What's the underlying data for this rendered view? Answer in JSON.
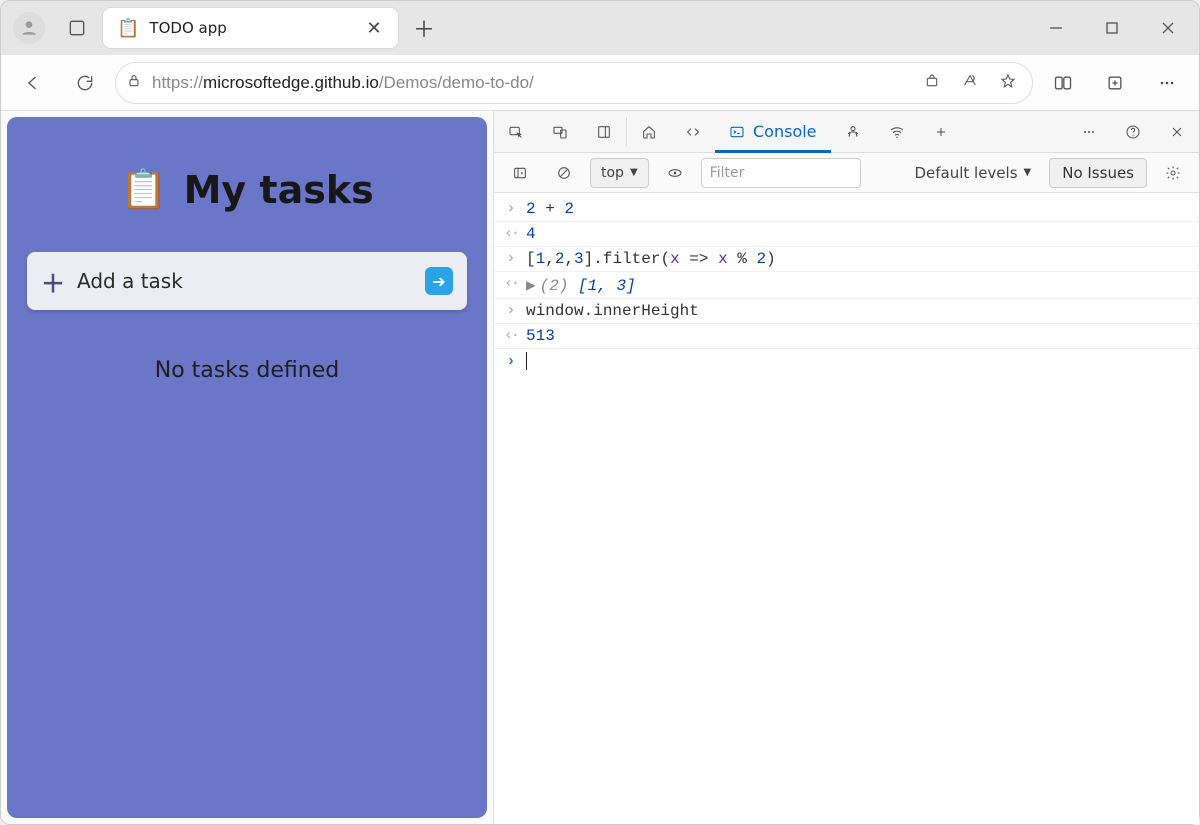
{
  "browser": {
    "tab_title": "TODO app",
    "url_faded_prefix": "https://",
    "url_host": "microsoftedge.github.io",
    "url_path": "/Demos/demo-to-do/"
  },
  "page": {
    "heading": "My tasks",
    "add_placeholder": "Add a task",
    "empty_state": "No tasks defined"
  },
  "devtools": {
    "tabs": {
      "console": "Console"
    },
    "filterbar": {
      "context": "top",
      "filter_placeholder": "Filter",
      "levels": "Default levels",
      "issues": "No Issues"
    },
    "console": {
      "entries": [
        {
          "type": "in",
          "tokens": [
            {
              "t": "2",
              "c": "num"
            },
            {
              "t": " + ",
              "c": "punc"
            },
            {
              "t": "2",
              "c": "num"
            }
          ]
        },
        {
          "type": "out",
          "tokens": [
            {
              "t": "4",
              "c": "num"
            }
          ]
        },
        {
          "type": "in",
          "tokens": [
            {
              "t": "[",
              "c": "punc"
            },
            {
              "t": "1",
              "c": "num"
            },
            {
              "t": ",",
              "c": "punc"
            },
            {
              "t": "2",
              "c": "num"
            },
            {
              "t": ",",
              "c": "punc"
            },
            {
              "t": "3",
              "c": "num"
            },
            {
              "t": "].filter(",
              "c": "punc"
            },
            {
              "t": "x",
              "c": "prop"
            },
            {
              "t": " => ",
              "c": "punc"
            },
            {
              "t": "x",
              "c": "prop"
            },
            {
              "t": " % ",
              "c": "punc"
            },
            {
              "t": "2",
              "c": "num"
            },
            {
              "t": ")",
              "c": "punc"
            }
          ]
        },
        {
          "type": "out",
          "expandable": true,
          "tokens": [
            {
              "t": "(2) ",
              "c": "dim"
            },
            {
              "t": "[1, 3]",
              "c": "arr"
            }
          ]
        },
        {
          "type": "in",
          "tokens": [
            {
              "t": "window.innerHeight",
              "c": "punc"
            }
          ]
        },
        {
          "type": "out",
          "tokens": [
            {
              "t": "513",
              "c": "num"
            }
          ]
        }
      ]
    }
  }
}
